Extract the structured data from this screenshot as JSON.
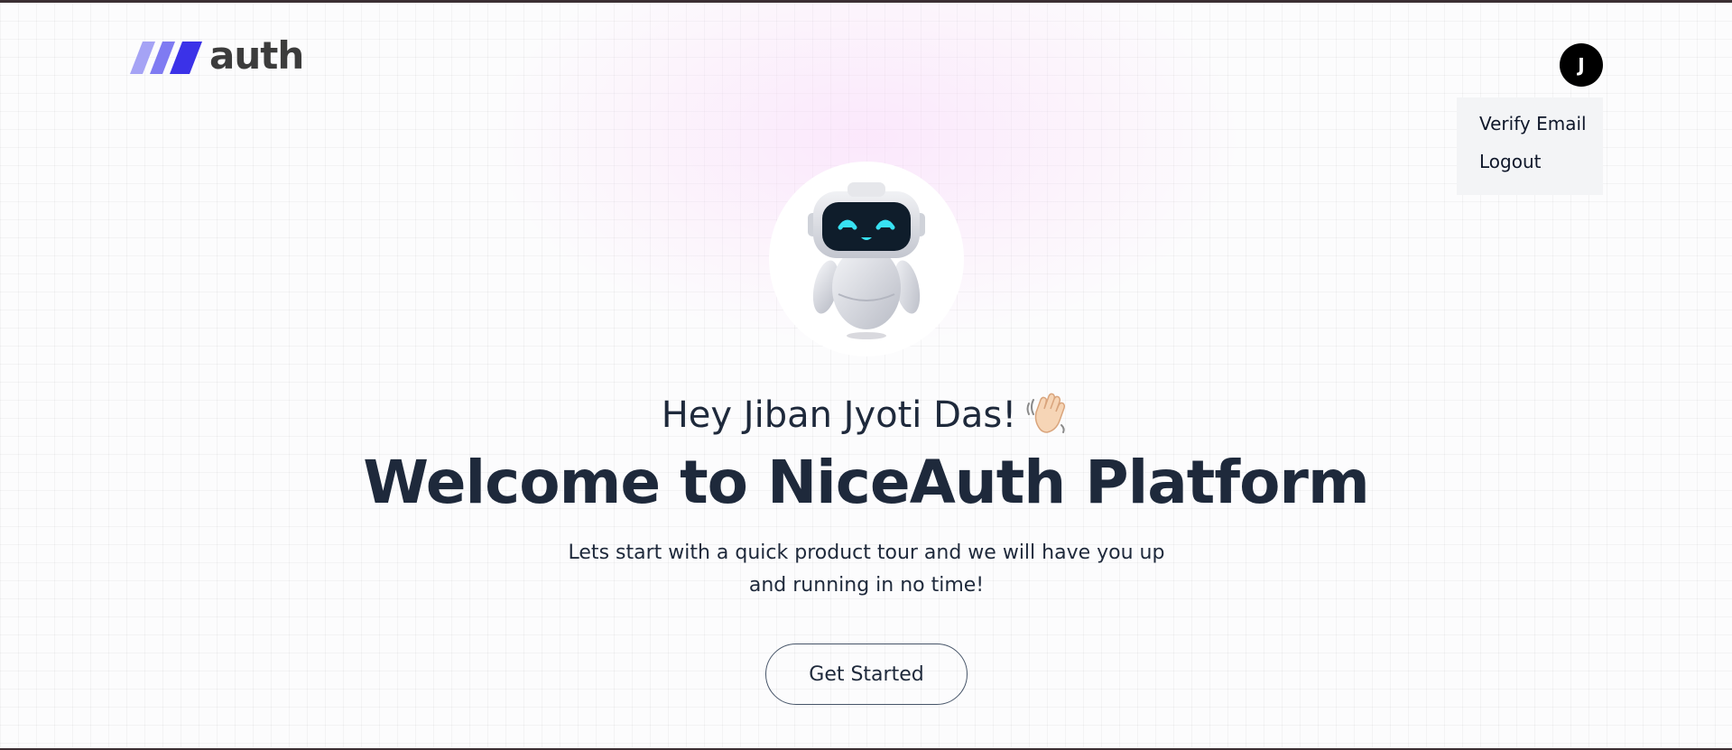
{
  "header": {
    "logo_text": "auth",
    "logo_icon": "three-slash-stripes-icon",
    "logo_colors": [
      "#a5a3f5",
      "#7f7bf2",
      "#3b32e8"
    ]
  },
  "user_menu": {
    "avatar_initial": "J",
    "items": [
      {
        "label": "Verify Email"
      },
      {
        "label": "Logout"
      }
    ]
  },
  "hero": {
    "illustration": "robot-icon",
    "greeting": "Hey Jiban Jyoti Das!",
    "greeting_emoji": "waving-hand-icon",
    "title": "Welcome to NiceAuth Platform",
    "subtitle": "Lets start with a quick product tour and we will have you up and running in no time!",
    "cta_label": "Get Started"
  },
  "colors": {
    "text": "#1e293b",
    "avatar_bg": "#000000",
    "dropdown_bg": "#f3f4f6",
    "robot_eyes": "#38e1f2"
  }
}
